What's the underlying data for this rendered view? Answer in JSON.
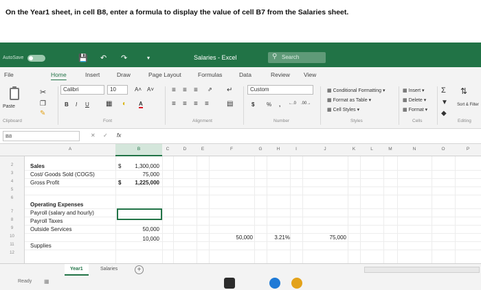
{
  "instruction": "On the Year1 sheet, in cell B8, enter a formula to display the value of cell B7 from the Salaries sheet.",
  "titlebar": {
    "autosave": "AutoSave",
    "toggle": "Off",
    "title": "Salaries - Excel",
    "search_placeholder": "Search"
  },
  "ribbon_tabs": [
    "File",
    "Home",
    "Insert",
    "Draw",
    "Page Layout",
    "Formulas",
    "Data",
    "Review",
    "View"
  ],
  "ribbon": {
    "paste_label": "Paste",
    "font_name": "Calibri",
    "font_size": "10",
    "number_format": "Custom",
    "cond_formatting": "Conditional Formatting",
    "format_table": "Format as Table",
    "cell_styles": "Cell Styles",
    "insert": "Insert",
    "delete": "Delete",
    "format": "Format",
    "sort_filter": "Sort & Filter",
    "groups": {
      "clipboard": "Clipboard",
      "font": "Font",
      "alignment": "Alignment",
      "number": "Number",
      "styles": "Styles",
      "cells": "Cells",
      "editing": "Editing"
    }
  },
  "formula_bar": {
    "name_box": "B8",
    "fx": "fx"
  },
  "columns": [
    "A",
    "B",
    "C",
    "D",
    "E",
    "F",
    "G",
    "H",
    "I",
    "J",
    "K",
    "L",
    "M",
    "N",
    "O",
    "P"
  ],
  "rows": [
    "2",
    "3",
    "4",
    "5",
    "6",
    "7",
    "8",
    "9",
    "10",
    "11",
    "12"
  ],
  "cells": {
    "a3": "Sales",
    "b3_sym": "$",
    "b3": "1,300,000",
    "a4": "Cost/ Goods Sold (COGS)",
    "b4": "75,000",
    "a5": "Gross Profit",
    "b5_sym": "$",
    "b5": "1,225,000",
    "a7": "Operating Expenses",
    "a8": "Payroll (salary and hourly)",
    "a9": "Payroll Taxes",
    "a10": "Outside Services",
    "b10": "50,000",
    "a11": "Supplies",
    "b11": "10,000",
    "g10": "50,000",
    "i10": "3.21%",
    "k10": "75,000"
  },
  "sheets": [
    "Year1",
    "Salaries"
  ],
  "status": "Ready"
}
